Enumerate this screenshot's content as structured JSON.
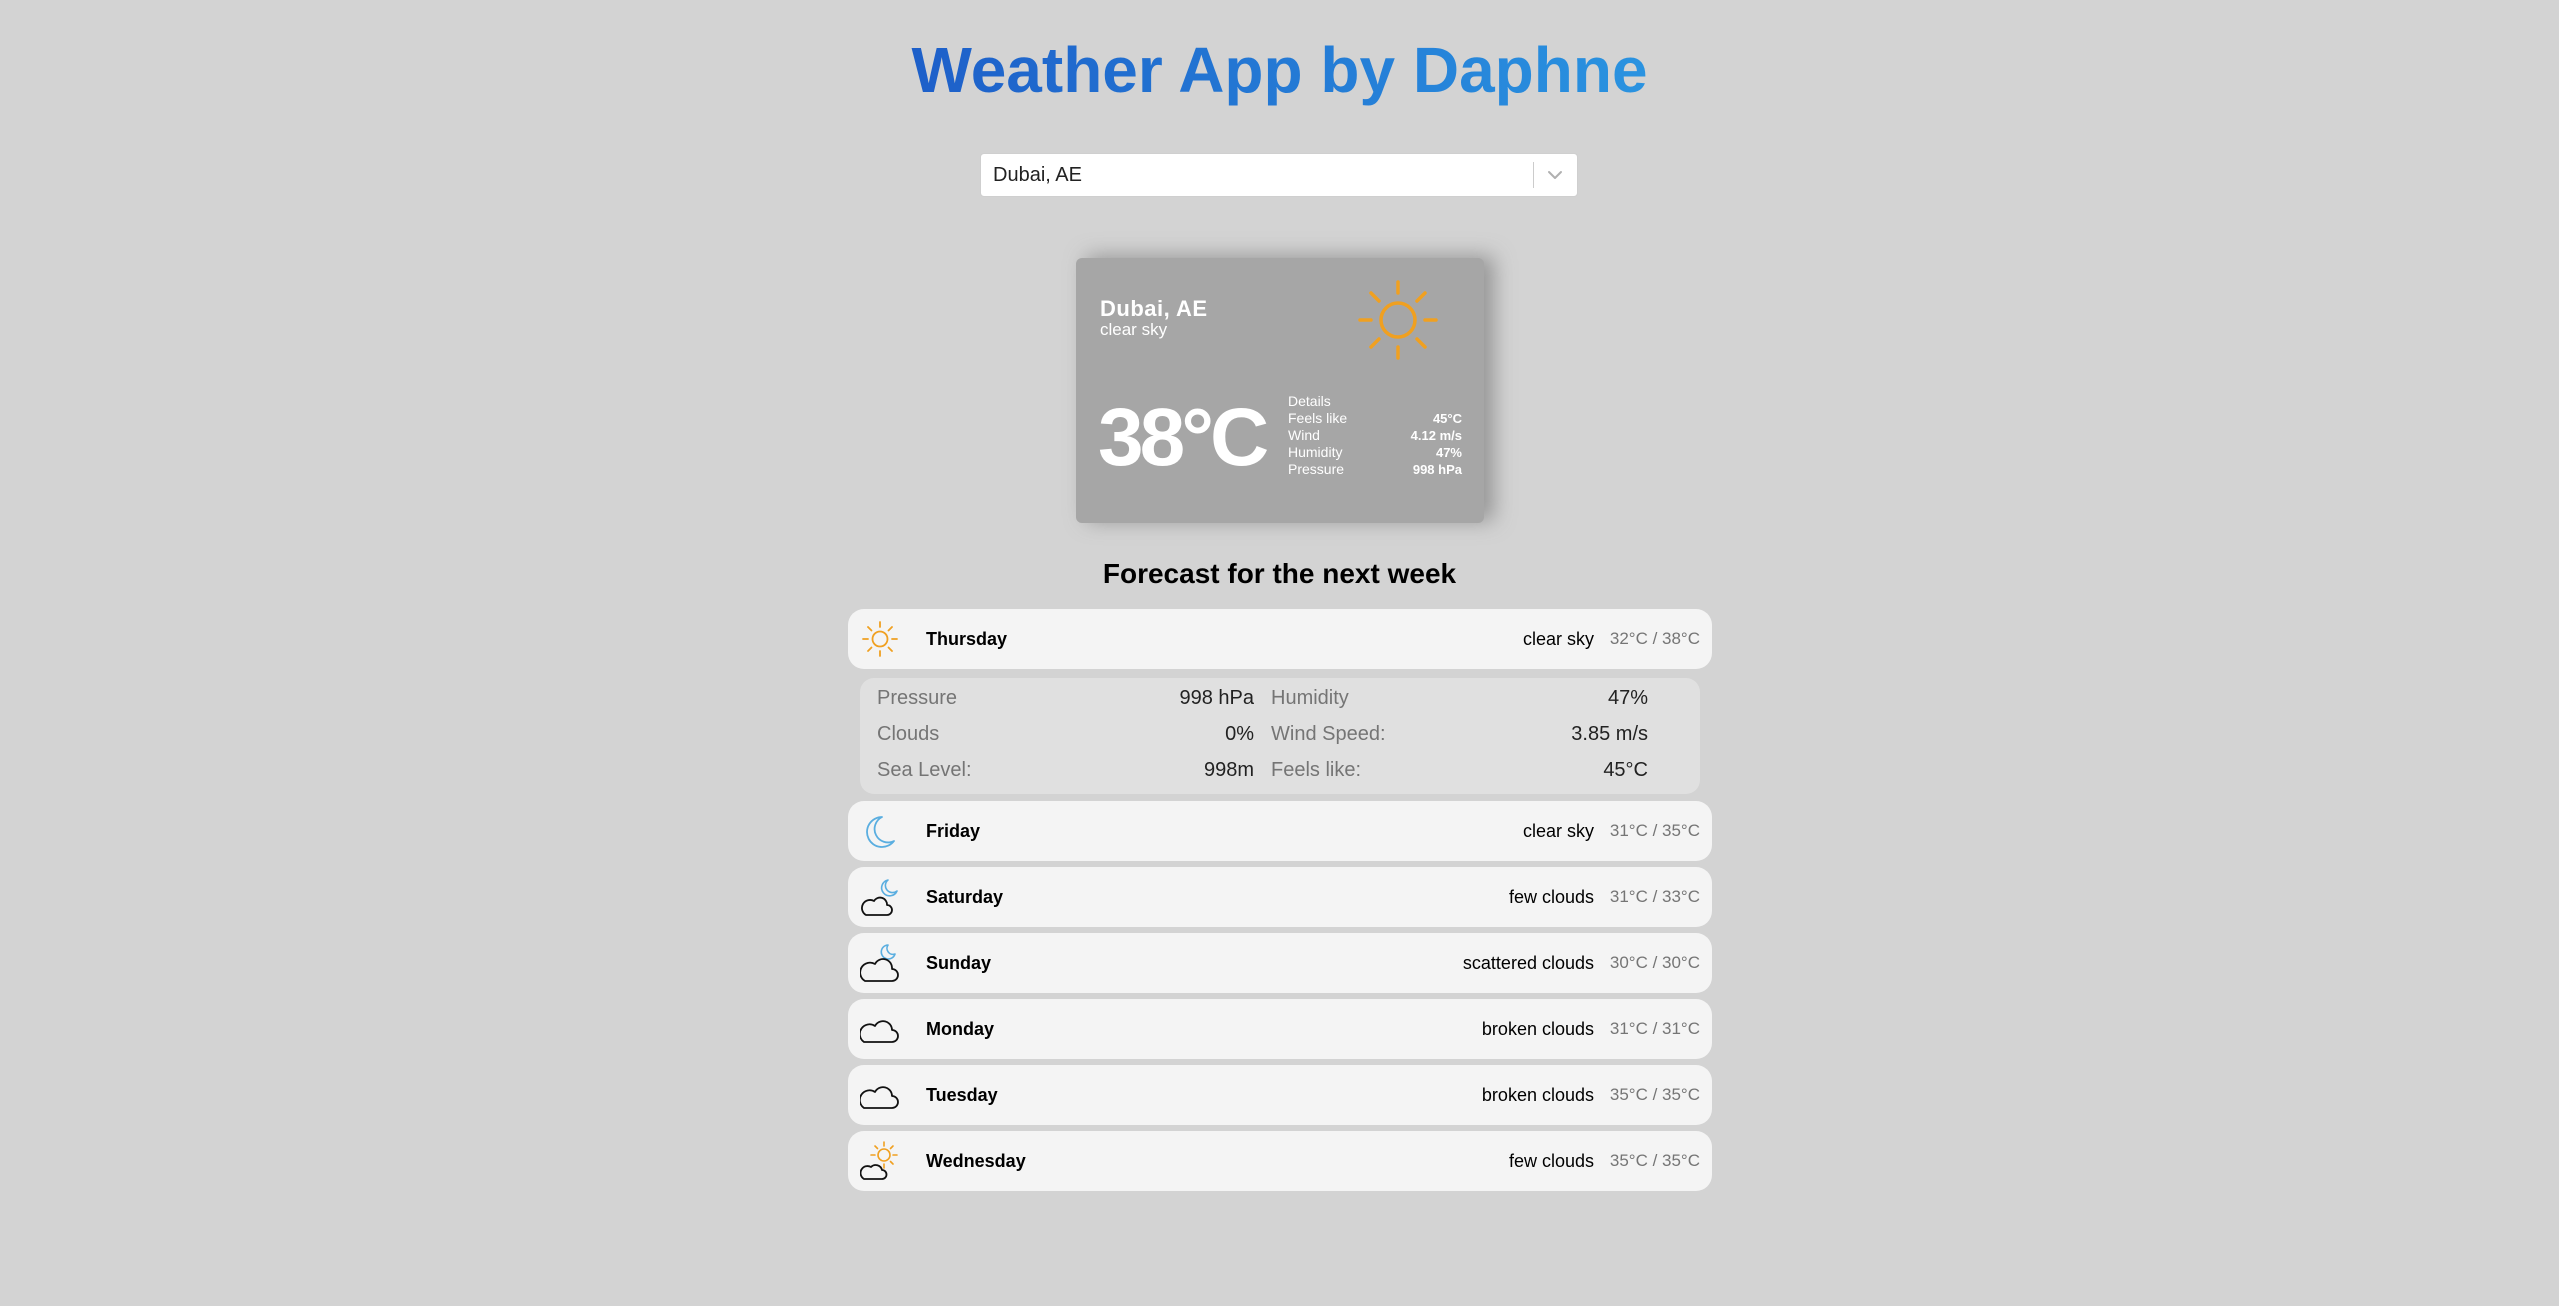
{
  "app": {
    "title": "Weather App by Daphne"
  },
  "search": {
    "value": "Dubai, AE",
    "dropdown_icon": "chevron-down-icon"
  },
  "current": {
    "city": "Dubai, AE",
    "description": "clear sky",
    "icon": "sun-icon",
    "temperature": "38°C",
    "details_label": "Details",
    "details": [
      {
        "label": "Feels like",
        "value": "45°C"
      },
      {
        "label": "Wind",
        "value": "4.12 m/s"
      },
      {
        "label": "Humidity",
        "value": "47%"
      },
      {
        "label": "Pressure",
        "value": "998 hPa"
      }
    ]
  },
  "forecast": {
    "title": "Forecast for the next week",
    "days": [
      {
        "name": "Thursday",
        "description": "clear sky",
        "range": "32°C / 38°C",
        "icon": "sun-icon"
      },
      {
        "name": "Friday",
        "description": "clear sky",
        "range": "31°C / 35°C",
        "icon": "moon-icon"
      },
      {
        "name": "Saturday",
        "description": "few clouds",
        "range": "31°C / 33°C",
        "icon": "cloud-moon-icon"
      },
      {
        "name": "Sunday",
        "description": "scattered clouds",
        "range": "30°C / 30°C",
        "icon": "cloud-moon-icon"
      },
      {
        "name": "Monday",
        "description": "broken clouds",
        "range": "31°C / 31°C",
        "icon": "cloud-icon"
      },
      {
        "name": "Tuesday",
        "description": "broken clouds",
        "range": "35°C / 35°C",
        "icon": "cloud-icon"
      },
      {
        "name": "Wednesday",
        "description": "few clouds",
        "range": "35°C / 35°C",
        "icon": "cloud-sun-icon"
      }
    ],
    "expanded": {
      "pressure_label": "Pressure",
      "pressure_value": "998 hPa",
      "humidity_label": "Humidity",
      "humidity_value": "47%",
      "clouds_label": "Clouds",
      "clouds_value": "0%",
      "wind_label": "Wind Speed:",
      "wind_value": "3.85 m/s",
      "sea_label": "Sea Level:",
      "sea_value": "998m",
      "feels_label": "Feels like:",
      "feels_value": "45°C"
    }
  },
  "colors": {
    "background": "#d3d3d3",
    "title_gradient_start": "#1d5fc9",
    "title_gradient_end": "#2a93e0",
    "card": "#a6a6a6",
    "sun": "#f0a020",
    "moon": "#5aaee0"
  }
}
